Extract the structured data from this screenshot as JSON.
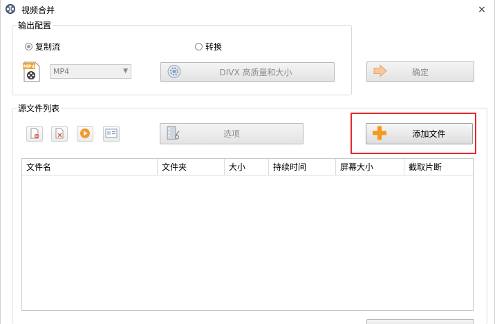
{
  "window": {
    "title": "视频合并",
    "close_label": "×"
  },
  "output_config": {
    "legend": "输出配置",
    "radio_copy": "复制流",
    "radio_convert": "转换",
    "format_value": "MP4",
    "format_icon_label": "MP4",
    "quality_label": "DIVX 高质量和大小",
    "confirm_label": "确定"
  },
  "source_files": {
    "legend": "源文件列表",
    "options_label": "选项",
    "add_file_label": "添加文件"
  },
  "table": {
    "columns": [
      "文件名",
      "文件夹",
      "大小",
      "持续时间",
      "屏幕大小",
      "截取片断"
    ]
  },
  "colors": {
    "highlight": "#e0292b",
    "add_icon": "#f39a1e"
  }
}
